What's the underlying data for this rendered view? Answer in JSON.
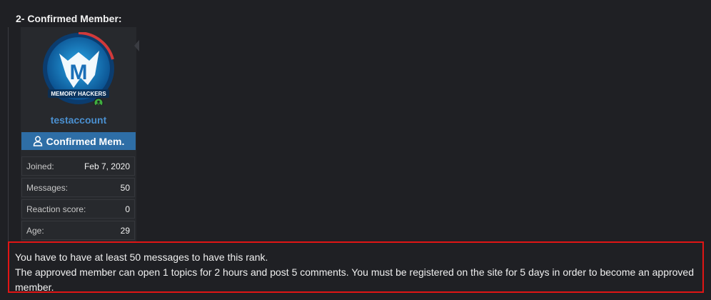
{
  "heading": "2- Confirmed Member:",
  "user": {
    "username": "testaccount",
    "avatar_text": "MEMORY HACKERS",
    "avatar_letter": "M",
    "rank_icon": "user-icon",
    "rank": "Confirmed Mem."
  },
  "stats": [
    {
      "label": "Joined:",
      "value": "Feb 7, 2020"
    },
    {
      "label": "Messages:",
      "value": "50"
    },
    {
      "label": "Reaction score:",
      "value": "0"
    },
    {
      "label": "Age:",
      "value": "29"
    }
  ],
  "notice": {
    "line1": "You have to have at least 50 messages to have this rank.",
    "line2": "The approved member can open 1 topics for 2 hours and post 5 comments. You must be registered on the site for 5 days in order to become an approved member."
  },
  "colors": {
    "background": "#1f2024",
    "username": "#4a8fcf",
    "rank_bar": "#2e6ea6",
    "notice_border": "#e01515",
    "online_dot": "#3fae3f"
  }
}
